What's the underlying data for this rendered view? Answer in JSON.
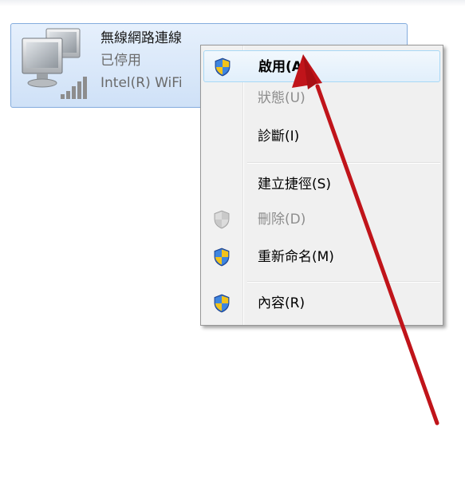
{
  "adapter": {
    "name": "無線網路連線",
    "status": "已停用",
    "device": "Intel(R) WiFi",
    "icon": "network-adapter-icon"
  },
  "context_menu": {
    "items": [
      {
        "label": "啟用(A)",
        "icon": "uac-shield-icon",
        "bold": true,
        "highlighted": true
      },
      {
        "label": "狀態(U)",
        "disabled": true
      },
      {
        "label": "診斷(I)"
      },
      {
        "label": "建立捷徑(S)"
      },
      {
        "label": "刪除(D)",
        "icon": "uac-shield-icon",
        "disabled": true
      },
      {
        "label": "重新命名(M)",
        "icon": "uac-shield-icon"
      },
      {
        "label": "內容(R)",
        "icon": "uac-shield-icon"
      }
    ]
  },
  "colors": {
    "selection_fill": "#cfe1f7",
    "selection_border": "#84acdd",
    "menu_highlight": "#e1effb",
    "annotation_arrow": "#c0141a"
  }
}
